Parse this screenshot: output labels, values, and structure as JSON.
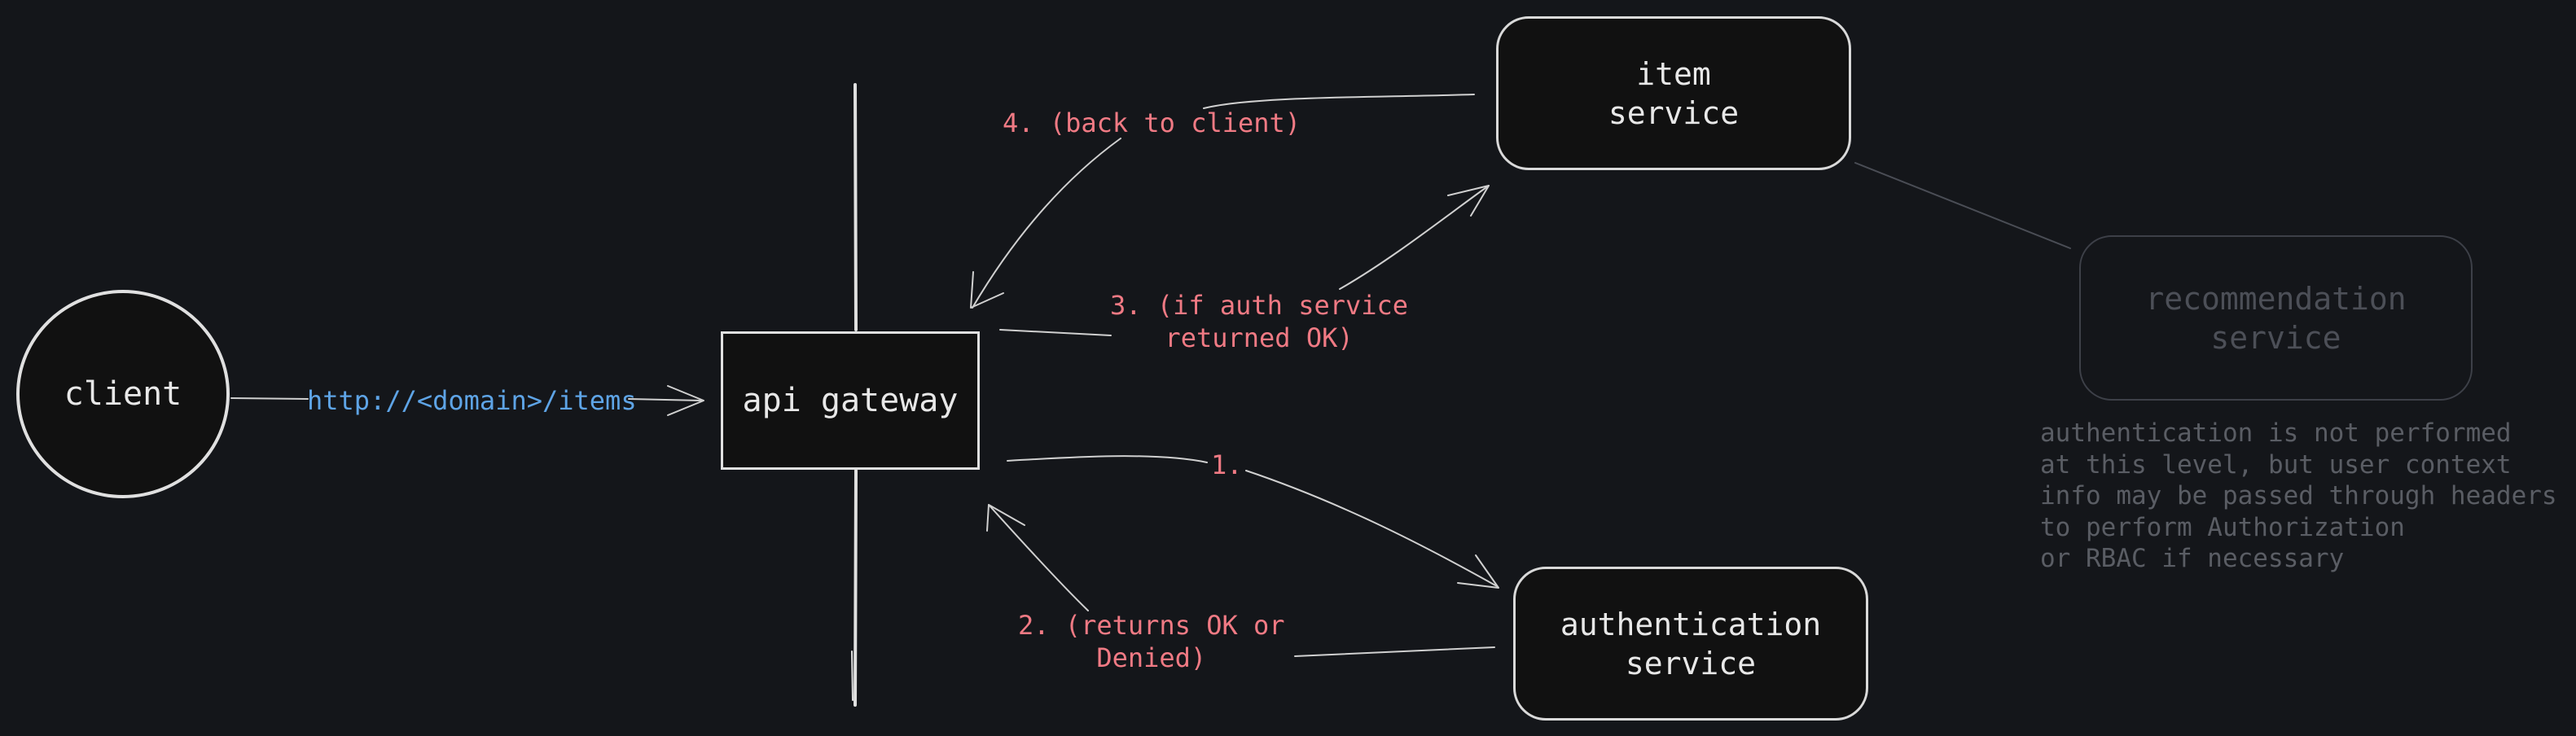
{
  "nodes": {
    "client": "client",
    "api_gateway": "api gateway",
    "item_service": "item\nservice",
    "authentication_service": "authentication\nservice",
    "recommendation_service": "recommendation\nservice"
  },
  "edges": {
    "client_to_gateway": "http://<domain>/items",
    "step_1": "1.",
    "step_2": "2. (returns OK or\nDenied)",
    "step_3": "3. (if auth service\nreturned OK)",
    "step_4": "4. (back to client)"
  },
  "note": "authentication is not performed\nat this level, but user context\ninfo may be passed through headers\nto perform Authorization\nor RBAC if necessary",
  "colors": {
    "background": "#14161a",
    "node_fill": "#111111",
    "node_stroke": "#d9d9d9",
    "step_label": "#f07a84",
    "request_label": "#5ea4e6",
    "faded": "#4c4f57"
  }
}
